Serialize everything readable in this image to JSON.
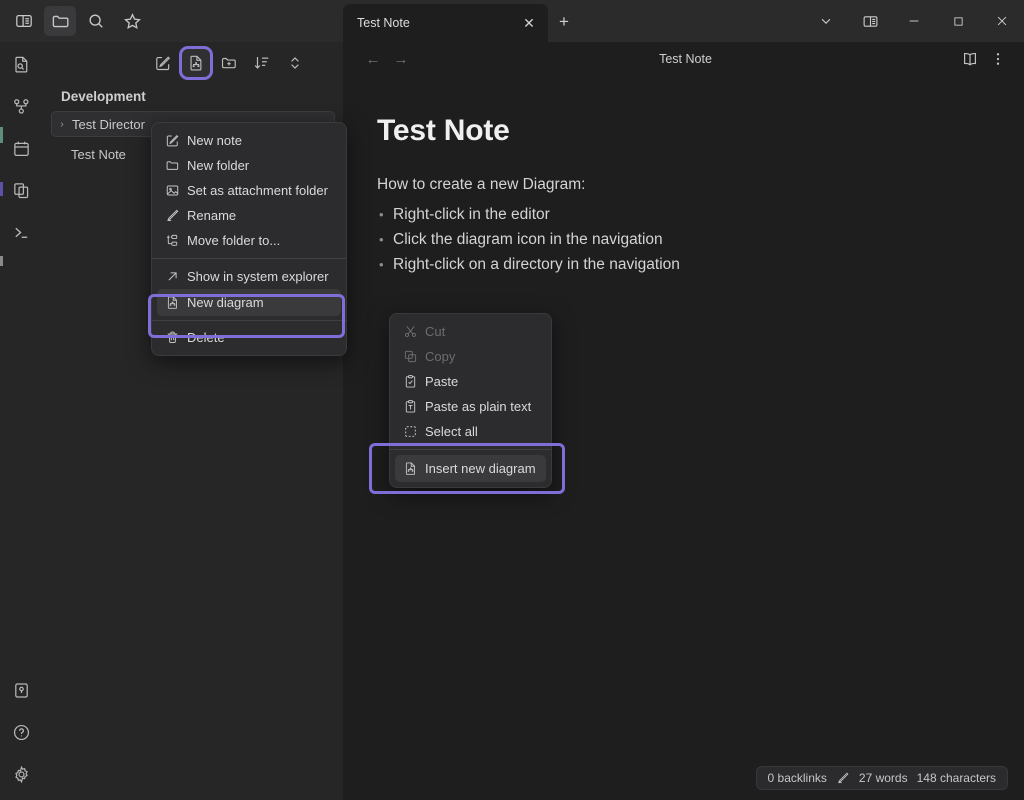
{
  "topbar": {
    "icons": [
      {
        "name": "toggle-sidebar-icon",
        "label": "Toggle sidebar"
      },
      {
        "name": "folder-icon",
        "label": "Files"
      },
      {
        "name": "search-icon",
        "label": "Search"
      },
      {
        "name": "star-icon",
        "label": "Favorites"
      }
    ],
    "tab": {
      "label": "Test Note",
      "close_label": "✕",
      "new_tab_label": "+"
    },
    "window_controls": [
      {
        "name": "chevron-down-icon",
        "label": "⌄"
      },
      {
        "name": "split-view-icon",
        "label": "Split view"
      },
      {
        "name": "minimize-icon",
        "label": "─"
      },
      {
        "name": "maximize-icon",
        "label": "□"
      },
      {
        "name": "close-window-icon",
        "label": "✕"
      }
    ]
  },
  "rail": {
    "top_items": [
      {
        "name": "file-search-icon",
        "label": "Search in files"
      },
      {
        "name": "graph-view-icon",
        "label": "Graph view"
      },
      {
        "name": "calendar-icon",
        "label": "Calendar"
      },
      {
        "name": "copy-pages-icon",
        "label": "Pages"
      },
      {
        "name": "terminal-icon",
        "label": "Terminal"
      }
    ],
    "bottom_items": [
      {
        "name": "plugins-icon",
        "label": "Plugins"
      },
      {
        "name": "help-icon",
        "label": "Help"
      },
      {
        "name": "settings-gear-icon",
        "label": "Settings"
      }
    ]
  },
  "sidebar": {
    "toolbar": [
      {
        "name": "new-note-icon",
        "label": "New note",
        "highlighted": false
      },
      {
        "name": "new-diagram-icon",
        "label": "New diagram",
        "highlighted": true
      },
      {
        "name": "new-folder-icon",
        "label": "New folder",
        "highlighted": false
      },
      {
        "name": "sort-icon",
        "label": "Sort",
        "highlighted": false
      },
      {
        "name": "collapse-expand-icon",
        "label": "Collapse / expand",
        "highlighted": false
      }
    ],
    "workspace_title": "Development",
    "tree": [
      {
        "name": "tree-folder-test-directory",
        "label": "Test Director",
        "type": "folder",
        "chevron": "›"
      },
      {
        "name": "tree-file-test-note",
        "label": "Test Note",
        "type": "file"
      }
    ]
  },
  "editor": {
    "header": {
      "back_label": "←",
      "forward_label": "→",
      "title": "Test Note",
      "actions": [
        {
          "name": "reading-mode-icon",
          "label": "Reading mode"
        },
        {
          "name": "more-options-icon",
          "label": "More options"
        }
      ]
    },
    "document": {
      "heading": "Test Note",
      "paragraph": "How to create a new Diagram:",
      "bullets": [
        "Right-click in the editor",
        "Click the diagram icon in the navigation",
        "Right-click on a directory in the navigation"
      ]
    }
  },
  "folder_menu": {
    "items": [
      {
        "name": "menu-new-note",
        "icon": "pencil-square-icon",
        "label": "New note",
        "disabled": false,
        "hover": false
      },
      {
        "name": "menu-new-folder",
        "icon": "folder-icon",
        "label": "New folder",
        "disabled": false,
        "hover": false
      },
      {
        "name": "menu-set-attachment-folder",
        "icon": "image-icon",
        "label": "Set as attachment folder",
        "disabled": false,
        "hover": false
      },
      {
        "name": "menu-rename",
        "icon": "pencil-icon",
        "label": "Rename",
        "disabled": false,
        "hover": false
      },
      {
        "name": "menu-move-folder-to",
        "icon": "move-tree-icon",
        "label": "Move folder to...",
        "disabled": false,
        "hover": false
      },
      {
        "name": "separator",
        "icon": "",
        "label": "",
        "separator": true
      },
      {
        "name": "menu-show-in-system-explorer",
        "icon": "arrow-out-icon",
        "label": "Show in system explorer",
        "disabled": false,
        "hover": false
      },
      {
        "name": "menu-new-diagram",
        "icon": "diagram-file-icon",
        "label": "New diagram",
        "disabled": false,
        "hover": true
      },
      {
        "name": "menu-delete",
        "icon": "trash-icon",
        "label": "Delete",
        "disabled": false,
        "hover": false
      }
    ]
  },
  "editor_menu": {
    "items": [
      {
        "name": "menu-cut",
        "icon": "scissors-icon",
        "label": "Cut",
        "disabled": true,
        "hover": false
      },
      {
        "name": "menu-copy",
        "icon": "copy-icon",
        "label": "Copy",
        "disabled": true,
        "hover": false
      },
      {
        "name": "menu-paste",
        "icon": "clipboard-check-icon",
        "label": "Paste",
        "disabled": false,
        "hover": false
      },
      {
        "name": "menu-paste-plain-text",
        "icon": "clipboard-text-icon",
        "label": "Paste as plain text",
        "disabled": false,
        "hover": false
      },
      {
        "name": "menu-select-all",
        "icon": "select-all-icon",
        "label": "Select all",
        "disabled": false,
        "hover": false
      },
      {
        "name": "menu-insert-new-diagram",
        "icon": "diagram-file-icon",
        "label": "Insert new diagram",
        "disabled": false,
        "hover": true
      }
    ]
  },
  "statusbar": {
    "backlinks": "0 backlinks",
    "pencil_icon": "pencil-icon",
    "words": "27 words",
    "characters": "148 characters"
  },
  "colors": {
    "accent_purple": "#7e6fd8",
    "editor_bg": "#1e1e1e",
    "panel_bg": "#262626",
    "topbar_bg": "#2b2b2b",
    "menu_bg": "#2c2c2e",
    "text": "#d6d6d6"
  }
}
